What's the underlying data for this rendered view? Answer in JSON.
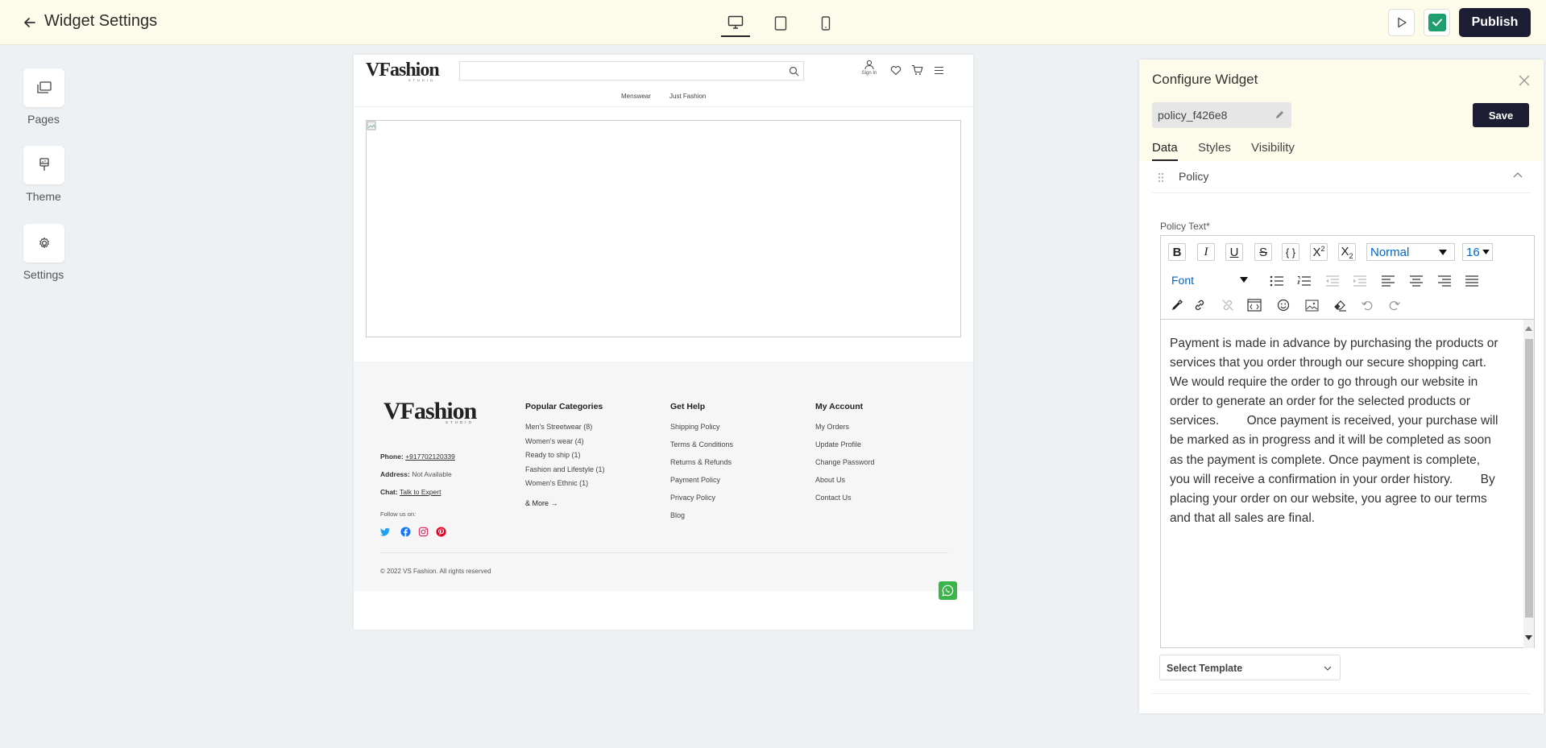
{
  "header": {
    "title": "Widget Settings",
    "publish_label": "Publish"
  },
  "sidebar": {
    "items": [
      {
        "label": "Pages",
        "icon": "pages-icon"
      },
      {
        "label": "Theme",
        "icon": "brush-icon"
      },
      {
        "label": "Settings",
        "icon": "gear-icon"
      }
    ]
  },
  "preview": {
    "logo_text": "VFashion",
    "logo_subtext": "STUDIO",
    "signin_label": "Sign In",
    "nav": [
      "Menswear",
      "Just Fashion"
    ],
    "footer": {
      "phone_label": "Phone:",
      "phone_value": "+917702120339",
      "address_label": "Address:",
      "address_value": "Not Available",
      "chat_label": "Chat:",
      "chat_value": "Talk to Expert",
      "follow_label": "Follow us on:",
      "popular_title": "Popular Categories",
      "popular": [
        "Men's Streetwear (8)",
        "Women's wear (4)",
        "Ready to ship (1)",
        "Fashion and Lifestyle (1)",
        "Women's Ethnic (1)"
      ],
      "more_label": "& More",
      "help_title": "Get Help",
      "help": [
        "Shipping Policy",
        "Terms & Conditions",
        "Returns & Refunds",
        "Payment Policy",
        "Privacy Policy",
        "Blog"
      ],
      "account_title": "My Account",
      "account": [
        "My Orders",
        "Update Profile",
        "Change Password",
        "About Us",
        "Contact Us"
      ],
      "copyright": "© 2022 VS Fashion. All rights reserved"
    }
  },
  "panel": {
    "title": "Configure Widget",
    "widget_name": "policy_f426e8",
    "save_label": "Save",
    "tabs": [
      "Data",
      "Styles",
      "Visibility"
    ],
    "section_title": "Policy",
    "policy_label": "Policy Text*",
    "format_select": "Normal",
    "size_select": "16",
    "font_select": "Font",
    "policy_text": "Payment is made in advance by purchasing the products or services that you order through our secure shopping cart. We would require the order to go through our website in order to generate an order for the selected products or services.        Once payment is received, your purchase will be marked as in progress and it will be completed as soon as the payment is complete. Once payment is complete, you will receive a confirmation in your order history.        By placing your order on our website, you agree to our terms and that all sales are final.",
    "template_select": "Select Template"
  },
  "colors": {
    "topbar_bg": "#fdfbea",
    "primary_dark": "#1d1e33",
    "check_green": "#1f9e6e",
    "whatsapp_green": "#3ab54a",
    "twitter": "#1da1f2",
    "facebook": "#1877f2",
    "instagram": "#e1306c",
    "pinterest": "#e60023"
  }
}
